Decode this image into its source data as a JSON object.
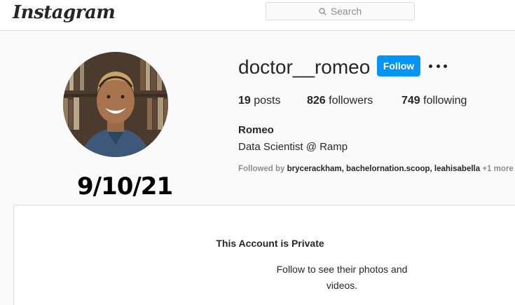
{
  "header": {
    "logo_text": "Instagram",
    "search_placeholder": "Search"
  },
  "profile": {
    "username": "doctor__romeo",
    "follow_label": "Follow",
    "posts_count": "19",
    "posts_label": "posts",
    "followers_count": "826",
    "followers_label": "followers",
    "following_count": "749",
    "following_label": "following",
    "full_name": "Romeo",
    "bio": "Data Scientist @ Ramp",
    "followed_by_prefix": "Followed by",
    "followed_by_names": "brycerackham, bachelornation.scoop, leahisabella",
    "followed_by_more": "+1 more"
  },
  "overlay": {
    "date_stamp": "9/10/21"
  },
  "private": {
    "title": "This Account is Private",
    "subtitle": "Follow to see their photos and videos."
  },
  "colors": {
    "accent": "#0095f6",
    "border": "#dbdbdb",
    "background": "#fafafa"
  }
}
